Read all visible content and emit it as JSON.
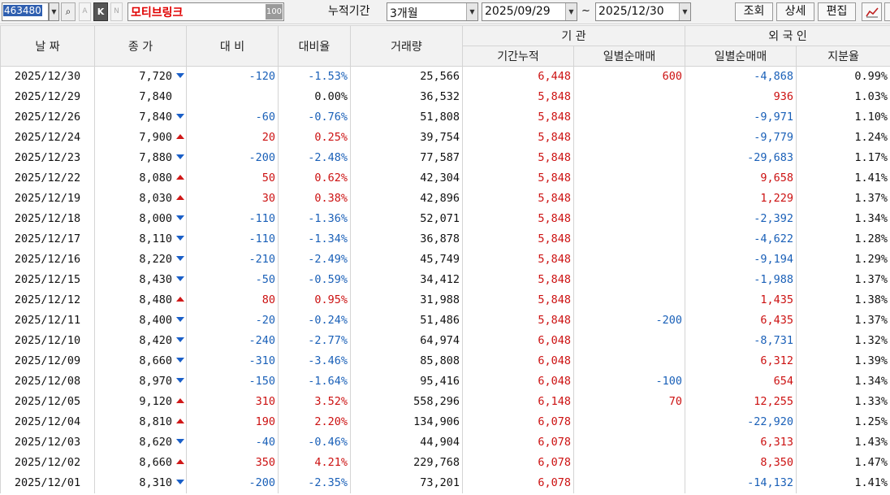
{
  "toolbar": {
    "stock_code": "463480",
    "small_btn_a": "A",
    "small_btn_k": "K",
    "small_btn_n": "N",
    "stock_name": "모티브링크",
    "name_extra": "100",
    "period_label": "누적기간",
    "period_value": "3개월",
    "start_date": "2025/09/29",
    "tilde": "~",
    "end_date": "2025/12/30",
    "query_btn": "조회",
    "detail_btn": "상세",
    "edit_btn": "편집",
    "chart_icon": "📈"
  },
  "colors": {
    "up": "#cc1111",
    "down": "#1a60b8",
    "header_bg": "#f2f2f2",
    "name_text": "#e00000"
  },
  "headers": {
    "date": "날  짜",
    "close": "종  가",
    "change": "대  비",
    "change_rate": "대비율",
    "volume": "거래량",
    "institution": "기      관",
    "inst_cum": "기간누적",
    "inst_daily": "일별순매매",
    "foreign": "외 국 인",
    "foreign_daily": "일별순매매",
    "foreign_ratio": "지분율"
  },
  "rows": [
    {
      "date": "2025/12/30",
      "close": "7,720",
      "dir": "down",
      "change": "-120",
      "rate": "-1.53%",
      "volume": "25,566",
      "inst_cum": "6,448",
      "inst_daily": "600",
      "inst_daily_dir": "up",
      "for_daily": "-4,868",
      "for_dir": "down",
      "ratio": "0.99%"
    },
    {
      "date": "2025/12/29",
      "close": "7,840",
      "dir": "none",
      "change": "",
      "rate": "0.00%",
      "volume": "36,532",
      "inst_cum": "5,848",
      "inst_daily": "",
      "inst_daily_dir": "none",
      "for_daily": "936",
      "for_dir": "up",
      "ratio": "1.03%"
    },
    {
      "date": "2025/12/26",
      "close": "7,840",
      "dir": "down",
      "change": "-60",
      "rate": "-0.76%",
      "volume": "51,808",
      "inst_cum": "5,848",
      "inst_daily": "",
      "inst_daily_dir": "none",
      "for_daily": "-9,971",
      "for_dir": "down",
      "ratio": "1.10%"
    },
    {
      "date": "2025/12/24",
      "close": "7,900",
      "dir": "up",
      "change": "20",
      "rate": "0.25%",
      "volume": "39,754",
      "inst_cum": "5,848",
      "inst_daily": "",
      "inst_daily_dir": "none",
      "for_daily": "-9,779",
      "for_dir": "down",
      "ratio": "1.24%"
    },
    {
      "date": "2025/12/23",
      "close": "7,880",
      "dir": "down",
      "change": "-200",
      "rate": "-2.48%",
      "volume": "77,587",
      "inst_cum": "5,848",
      "inst_daily": "",
      "inst_daily_dir": "none",
      "for_daily": "-29,683",
      "for_dir": "down",
      "ratio": "1.17%"
    },
    {
      "date": "2025/12/22",
      "close": "8,080",
      "dir": "up",
      "change": "50",
      "rate": "0.62%",
      "volume": "42,304",
      "inst_cum": "5,848",
      "inst_daily": "",
      "inst_daily_dir": "none",
      "for_daily": "9,658",
      "for_dir": "up",
      "ratio": "1.41%"
    },
    {
      "date": "2025/12/19",
      "close": "8,030",
      "dir": "up",
      "change": "30",
      "rate": "0.38%",
      "volume": "42,896",
      "inst_cum": "5,848",
      "inst_daily": "",
      "inst_daily_dir": "none",
      "for_daily": "1,229",
      "for_dir": "up",
      "ratio": "1.37%"
    },
    {
      "date": "2025/12/18",
      "close": "8,000",
      "dir": "down",
      "change": "-110",
      "rate": "-1.36%",
      "volume": "52,071",
      "inst_cum": "5,848",
      "inst_daily": "",
      "inst_daily_dir": "none",
      "for_daily": "-2,392",
      "for_dir": "down",
      "ratio": "1.34%"
    },
    {
      "date": "2025/12/17",
      "close": "8,110",
      "dir": "down",
      "change": "-110",
      "rate": "-1.34%",
      "volume": "36,878",
      "inst_cum": "5,848",
      "inst_daily": "",
      "inst_daily_dir": "none",
      "for_daily": "-4,622",
      "for_dir": "down",
      "ratio": "1.28%"
    },
    {
      "date": "2025/12/16",
      "close": "8,220",
      "dir": "down",
      "change": "-210",
      "rate": "-2.49%",
      "volume": "45,749",
      "inst_cum": "5,848",
      "inst_daily": "",
      "inst_daily_dir": "none",
      "for_daily": "-9,194",
      "for_dir": "down",
      "ratio": "1.29%"
    },
    {
      "date": "2025/12/15",
      "close": "8,430",
      "dir": "down",
      "change": "-50",
      "rate": "-0.59%",
      "volume": "34,412",
      "inst_cum": "5,848",
      "inst_daily": "",
      "inst_daily_dir": "none",
      "for_daily": "-1,988",
      "for_dir": "down",
      "ratio": "1.37%"
    },
    {
      "date": "2025/12/12",
      "close": "8,480",
      "dir": "up",
      "change": "80",
      "rate": "0.95%",
      "volume": "31,988",
      "inst_cum": "5,848",
      "inst_daily": "",
      "inst_daily_dir": "none",
      "for_daily": "1,435",
      "for_dir": "up",
      "ratio": "1.38%"
    },
    {
      "date": "2025/12/11",
      "close": "8,400",
      "dir": "down",
      "change": "-20",
      "rate": "-0.24%",
      "volume": "51,486",
      "inst_cum": "5,848",
      "inst_daily": "-200",
      "inst_daily_dir": "down",
      "for_daily": "6,435",
      "for_dir": "up",
      "ratio": "1.37%"
    },
    {
      "date": "2025/12/10",
      "close": "8,420",
      "dir": "down",
      "change": "-240",
      "rate": "-2.77%",
      "volume": "64,974",
      "inst_cum": "6,048",
      "inst_daily": "",
      "inst_daily_dir": "none",
      "for_daily": "-8,731",
      "for_dir": "down",
      "ratio": "1.32%"
    },
    {
      "date": "2025/12/09",
      "close": "8,660",
      "dir": "down",
      "change": "-310",
      "rate": "-3.46%",
      "volume": "85,808",
      "inst_cum": "6,048",
      "inst_daily": "",
      "inst_daily_dir": "none",
      "for_daily": "6,312",
      "for_dir": "up",
      "ratio": "1.39%"
    },
    {
      "date": "2025/12/08",
      "close": "8,970",
      "dir": "down",
      "change": "-150",
      "rate": "-1.64%",
      "volume": "95,416",
      "inst_cum": "6,048",
      "inst_daily": "-100",
      "inst_daily_dir": "down",
      "for_daily": "654",
      "for_dir": "up",
      "ratio": "1.34%"
    },
    {
      "date": "2025/12/05",
      "close": "9,120",
      "dir": "up",
      "change": "310",
      "rate": "3.52%",
      "volume": "558,296",
      "inst_cum": "6,148",
      "inst_daily": "70",
      "inst_daily_dir": "up",
      "for_daily": "12,255",
      "for_dir": "up",
      "ratio": "1.33%"
    },
    {
      "date": "2025/12/04",
      "close": "8,810",
      "dir": "up",
      "change": "190",
      "rate": "2.20%",
      "volume": "134,906",
      "inst_cum": "6,078",
      "inst_daily": "",
      "inst_daily_dir": "none",
      "for_daily": "-22,920",
      "for_dir": "down",
      "ratio": "1.25%"
    },
    {
      "date": "2025/12/03",
      "close": "8,620",
      "dir": "down",
      "change": "-40",
      "rate": "-0.46%",
      "volume": "44,904",
      "inst_cum": "6,078",
      "inst_daily": "",
      "inst_daily_dir": "none",
      "for_daily": "6,313",
      "for_dir": "up",
      "ratio": "1.43%"
    },
    {
      "date": "2025/12/02",
      "close": "8,660",
      "dir": "up",
      "change": "350",
      "rate": "4.21%",
      "volume": "229,768",
      "inst_cum": "6,078",
      "inst_daily": "",
      "inst_daily_dir": "none",
      "for_daily": "8,350",
      "for_dir": "up",
      "ratio": "1.47%"
    },
    {
      "date": "2025/12/01",
      "close": "8,310",
      "dir": "down",
      "change": "-200",
      "rate": "-2.35%",
      "volume": "73,201",
      "inst_cum": "6,078",
      "inst_daily": "",
      "inst_daily_dir": "none",
      "for_daily": "-14,132",
      "for_dir": "down",
      "ratio": "1.41%"
    }
  ]
}
